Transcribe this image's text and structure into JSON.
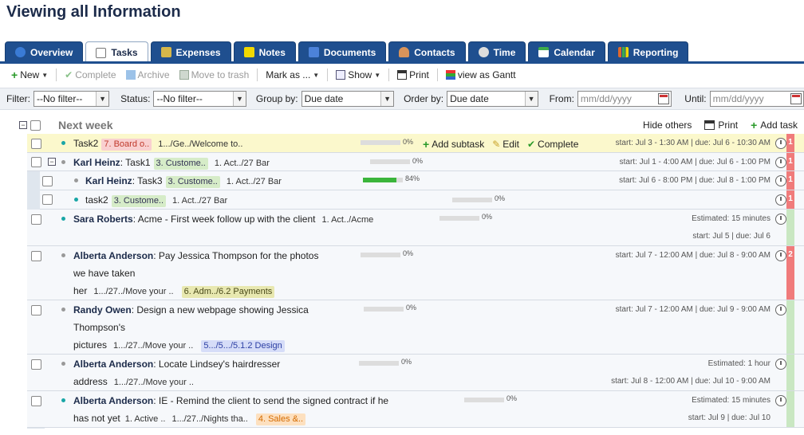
{
  "page_title": "Viewing all Information",
  "tabs": [
    {
      "label": "Overview",
      "icon": "globe-icon",
      "color": "#3a7bd5"
    },
    {
      "label": "Tasks",
      "icon": "tasks-icon",
      "color": "#888888",
      "active": true
    },
    {
      "label": "Expenses",
      "icon": "expenses-icon",
      "color": "#d6b74a"
    },
    {
      "label": "Notes",
      "icon": "notes-icon",
      "color": "#f2d900"
    },
    {
      "label": "Documents",
      "icon": "documents-icon",
      "color": "#4c82d9"
    },
    {
      "label": "Contacts",
      "icon": "contacts-icon",
      "color": "#d9945a"
    },
    {
      "label": "Time",
      "icon": "clock-icon",
      "color": "#cccccc"
    },
    {
      "label": "Calendar",
      "icon": "calendar-icon",
      "color": "#3dab4a"
    },
    {
      "label": "Reporting",
      "icon": "chart-icon",
      "color": "#e0682b"
    }
  ],
  "toolbar": {
    "new": "New",
    "complete": "Complete",
    "archive": "Archive",
    "trash": "Move to trash",
    "mark_as": "Mark as ...",
    "show": "Show",
    "print": "Print",
    "gantt": "view as Gantt"
  },
  "filters": {
    "filter_label": "Filter:",
    "filter_value": "--No filter--",
    "status_label": "Status:",
    "status_value": "--No filter--",
    "groupby_label": "Group by:",
    "groupby_value": "Due date",
    "orderby_label": "Order by:",
    "orderby_value": "Due date",
    "from_label": "From:",
    "from_placeholder": "mm/dd/yyyy",
    "until_label": "Until:",
    "until_placeholder": "mm/dd/yyyy"
  },
  "group": {
    "title": "Next week",
    "hide_others": "Hide others",
    "print": "Print",
    "add_task": "Add task"
  },
  "row_actions": {
    "add_subtask": "Add subtask",
    "edit": "Edit",
    "complete": "Complete"
  },
  "tasks": [
    {
      "assignee": "",
      "title": "Task2",
      "tag1": "7. Board o..",
      "path": "1.../Ge../Welcome to..",
      "progress": 0,
      "progress_label": "0%",
      "dates": "start: Jul 3 - 1:30 AM | due: Jul 6 - 10:30 AM",
      "priority": "1"
    },
    {
      "assignee": "Karl Heinz",
      "title": ": Task1",
      "tag1": "3. Custome..",
      "path": "1. Act../27 Bar",
      "progress": 0,
      "progress_label": "0%",
      "dates": "start: Jul 1 - 4:00 AM | due: Jul 6 - 1:00 PM",
      "priority": "1"
    },
    {
      "assignee": "Karl Heinz",
      "title": ": Task3",
      "tag1": "3. Custome..",
      "path": "1. Act../27 Bar",
      "progress": 84,
      "progress_label": "84%",
      "dates": "start: Jul 6 - 8:00 PM | due: Jul 8 - 1:00 PM",
      "priority": "1"
    },
    {
      "assignee": "",
      "title": "task2",
      "tag1": "3. Custome..",
      "path": "1. Act../27 Bar",
      "progress": 0,
      "progress_label": "0%",
      "dates": "",
      "priority": "1"
    },
    {
      "assignee": "Sara Roberts",
      "title": ": Acme - First week follow up with the client",
      "tag1": "",
      "path": "1. Act../Acme",
      "progress": 0,
      "progress_label": "0%",
      "estimated": "Estimated: 15 minutes",
      "dates": "start: Jul 5 | due: Jul 6",
      "priority": ""
    },
    {
      "assignee": "Alberta Anderson",
      "title": ": Pay Jessica Thompson for the photos",
      "line2": "we have taken",
      "line3": "her",
      "path": "1.../27../Move your ..",
      "tag1": "6. Adm../6.2 Payments",
      "progress": 0,
      "progress_label": "0%",
      "dates": "start: Jul 7 - 12:00 AM | due: Jul 8 - 9:00 AM",
      "priority": "2"
    },
    {
      "assignee": "Randy Owen",
      "title": ": Design a new webpage showing Jessica",
      "line2": "Thompson's",
      "line3": "pictures",
      "path": "1.../27../Move your ..",
      "tag1": "5.../5.../5.1.2 Design",
      "progress": 0,
      "progress_label": "0%",
      "dates": "start: Jul 7 - 12:00 AM | due: Jul 9 - 9:00 AM",
      "priority": ""
    },
    {
      "assignee": "Alberta Anderson",
      "title": ": Locate Lindsey's hairdresser",
      "line2": "address",
      "path": "1.../27../Move your ..",
      "progress": 0,
      "progress_label": "0%",
      "estimated": "Estimated: 1 hour",
      "dates": "start: Jul 8 - 12:00 AM | due: Jul 10 - 9:00 AM",
      "priority": ""
    },
    {
      "assignee": "Alberta Anderson",
      "title": ": IE - Remind the client to send the signed contract if he",
      "line2": "has not yet",
      "path": "1. Active ..",
      "path2": "1.../27../Nights tha..",
      "tag1": "4. Sales &..",
      "progress": 0,
      "progress_label": "0%",
      "estimated": "Estimated: 15 minutes",
      "dates": "start: Jul 9 | due: Jul 10",
      "priority": ""
    }
  ]
}
